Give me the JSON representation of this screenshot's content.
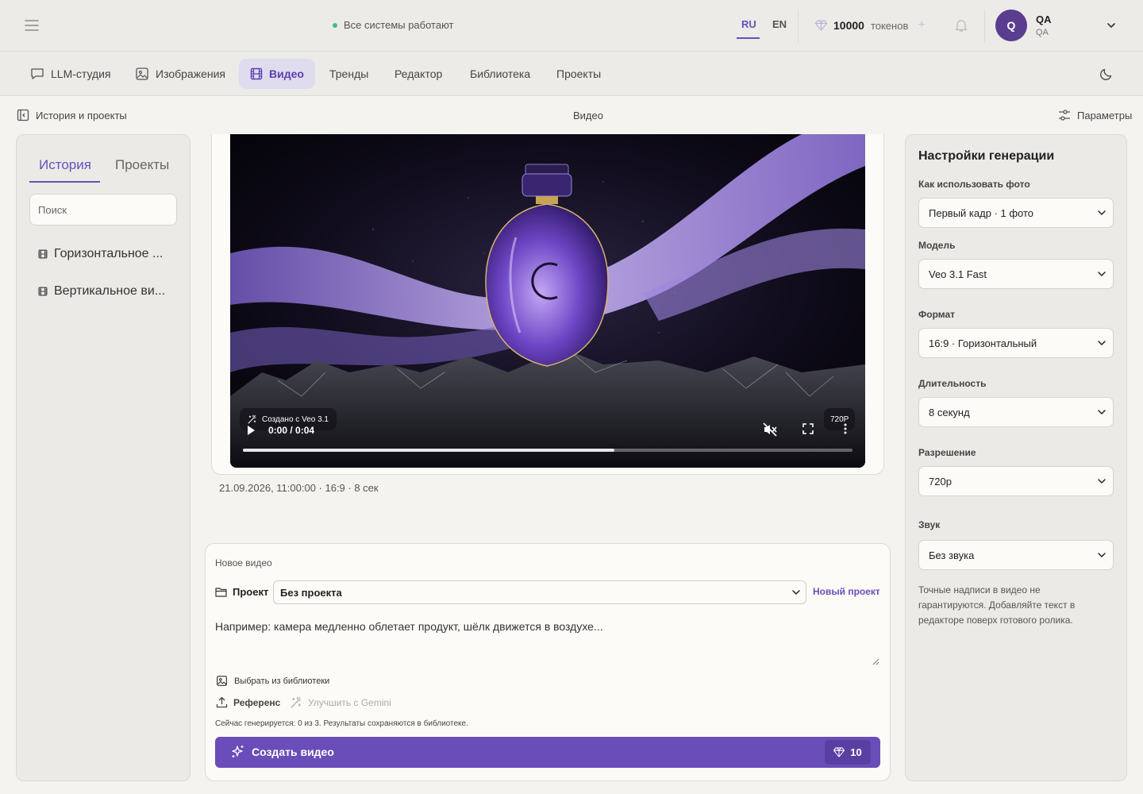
{
  "topbar": {
    "status_text": "Все системы работают",
    "lang_ru": "RU",
    "lang_en": "EN",
    "tokens_value": "10000",
    "tokens_label": "токенов",
    "plus": "+",
    "avatar_letter": "Q",
    "user_name": "QA",
    "user_sub": "QA"
  },
  "nav": {
    "items": [
      {
        "label": "LLM-студия",
        "icon": "chat-icon"
      },
      {
        "label": "Изображения",
        "icon": "image-icon"
      },
      {
        "label": "Видео",
        "icon": "film-icon",
        "active": true
      },
      {
        "label": "Тренды"
      },
      {
        "label": "Редактор"
      },
      {
        "label": "Библиотека"
      },
      {
        "label": "Проекты"
      }
    ]
  },
  "subheader": {
    "left": "История и проекты",
    "center": "Видео",
    "right": "Параметры"
  },
  "history": {
    "tab_history": "История",
    "tab_projects": "Проекты",
    "search_placeholder": "Поиск",
    "items": [
      {
        "label": "Горизонтальное ..."
      },
      {
        "label": "Вертикальное ви..."
      }
    ]
  },
  "video": {
    "badge_created": "Создано с Veo 3.1",
    "resolution_badge": "720P",
    "time": "0:00 / 0:04",
    "progress": 0.61,
    "meta": "21.09.2026, 11:00:00 · 16:9 · 8 сек"
  },
  "new_video": {
    "title": "Новое видео",
    "project_label": "Проект",
    "project_value": "Без проекта",
    "new_project": "Новый проект",
    "prompt_placeholder": "Например: камера медленно облетает продукт, шёлк движется в воздухе...",
    "from_library": "Выбрать из библиотеки",
    "reference": "Референс",
    "improve_gemini": "Улучшить с Gemini",
    "status": "Сейчас генерируется: 0 из 3. Результаты сохраняются в библиотеке.",
    "create_button": "Создать видео",
    "cost": "10"
  },
  "settings": {
    "title": "Настройки генерации",
    "fields": [
      {
        "label": "Как использовать фото",
        "value": "Первый кадр · 1 фото"
      },
      {
        "label": "Модель",
        "value": "Veo 3.1 Fast"
      },
      {
        "label": "Формат",
        "value": "16:9 · Горизонтальный"
      },
      {
        "label": "Длительность",
        "value": "8 секунд"
      },
      {
        "label": "Разрешение",
        "value": "720p"
      },
      {
        "label": "Звук",
        "value": "Без звука"
      }
    ],
    "note": "Точные надписи в видео не гарантируются. Добавляйте текст в редакторе поверх готового ролика."
  },
  "colors": {
    "accent": "#6b4fbb",
    "status_ok": "#3fbf83",
    "avatar_bg": "#5a3d8f",
    "create_button_bg": "#6a4db8"
  }
}
